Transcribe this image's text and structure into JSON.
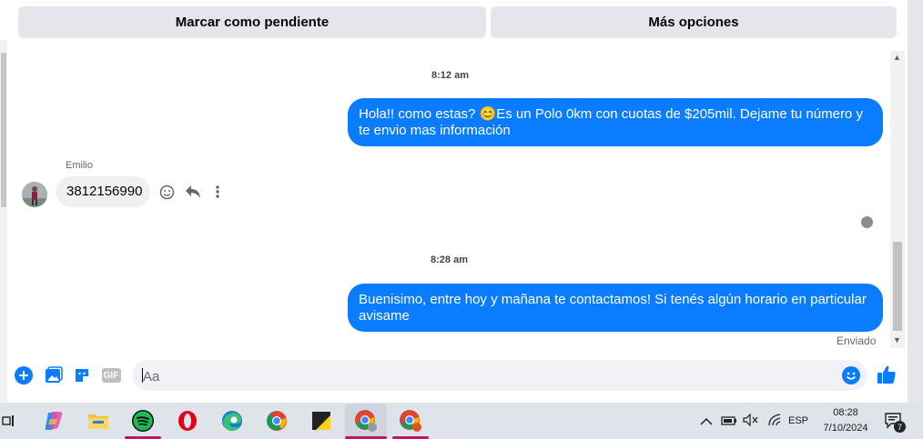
{
  "header": {
    "mark_pending_label": "Marcar como pendiente",
    "more_options_label": "Más opciones"
  },
  "conversation": {
    "timestamp_1": "8:12 am",
    "message_1": "Hola!! como estas? 😊Es un Polo 0km con cuotas de $205mil. Dejame tu número y te envio mas información",
    "sender_name": "Emilio",
    "incoming_message": "3812156990",
    "timestamp_2": "8:28 am",
    "message_2": "Buenisimo, entre hoy y mañana te contactamos! Si tenés algún horario en particular avisame",
    "delivery_status": "Enviado"
  },
  "composer": {
    "placeholder": "Aa",
    "icons": [
      "plus-icon",
      "image-icon",
      "sticker-icon",
      "gif-icon",
      "emoji-icon",
      "thumbs-up-icon"
    ],
    "gif_label": "GIF"
  },
  "taskbar": {
    "apps": [
      "task-view",
      "copilot",
      "file-explorer",
      "spotify",
      "opera",
      "edge",
      "chrome",
      "sticky-notes",
      "chrome-profile",
      "chrome-profile-2"
    ],
    "language": "ESP",
    "time": "08:28",
    "date": "7/10/2024",
    "notification_count": "7"
  },
  "colors": {
    "accent": "#0a7cff",
    "outgoing_bubble": "#0a7cff",
    "incoming_bubble": "#f0f0f0",
    "taskbar_underline": "#c2185b"
  }
}
